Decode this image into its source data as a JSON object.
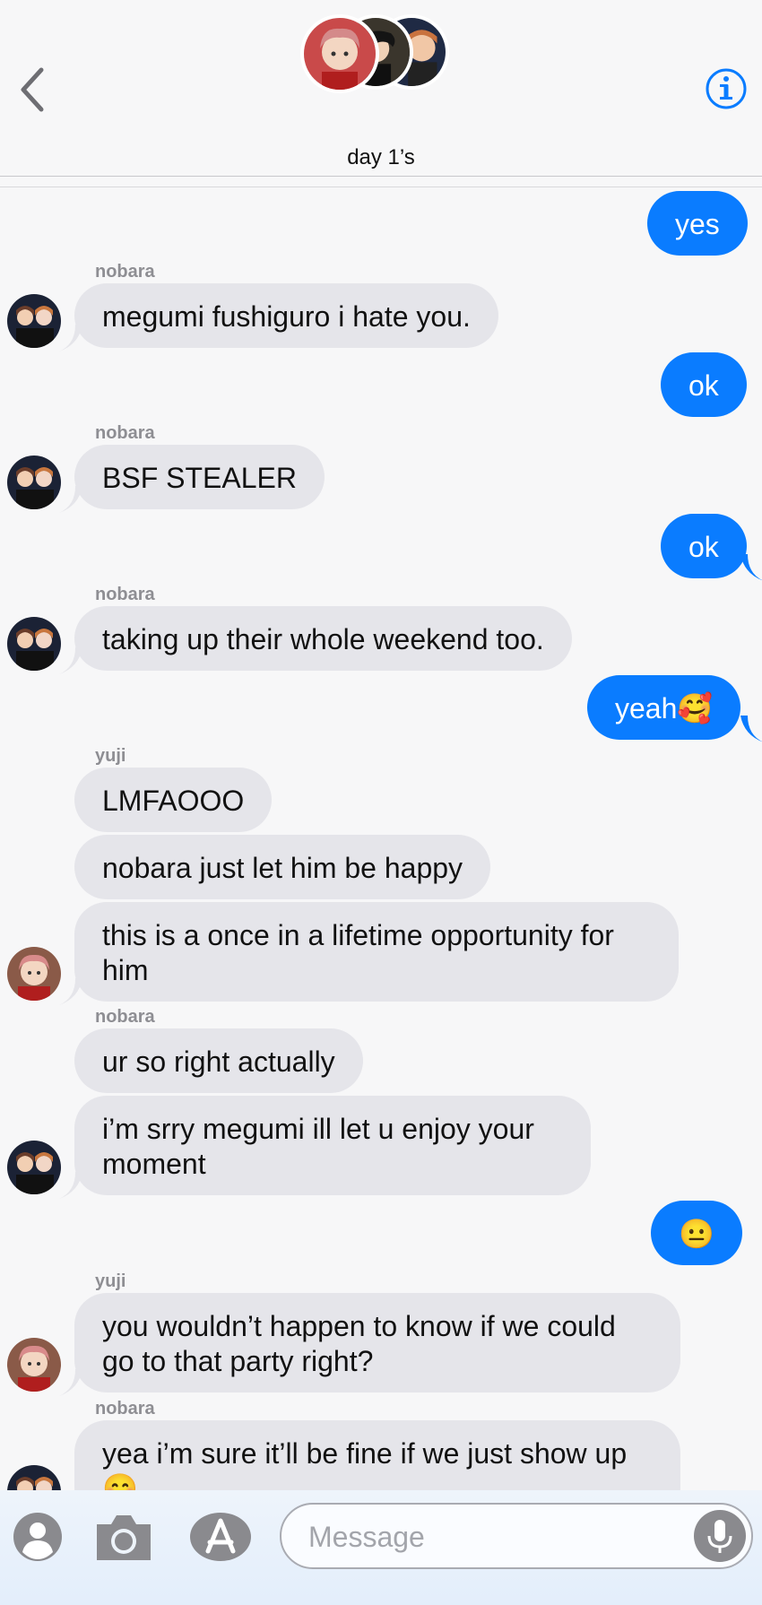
{
  "header": {
    "title": "day 1’s",
    "icons": {
      "back": "chevron-left-icon",
      "info": "info-icon"
    },
    "accent": "#0a7cff"
  },
  "messages": [
    {
      "side": "sent",
      "text": "yes"
    },
    {
      "side": "recv",
      "sender": "nobara",
      "text": "megumi fushiguro i hate you."
    },
    {
      "side": "sent",
      "text": "ok"
    },
    {
      "side": "recv",
      "sender": "nobara",
      "text": "BSF STEALER"
    },
    {
      "side": "sent",
      "text": "ok"
    },
    {
      "side": "recv",
      "sender": "nobara",
      "text": "taking up their whole weekend too."
    },
    {
      "side": "sent",
      "text": "yeah🥰"
    },
    {
      "side": "recv",
      "sender": "yuji",
      "text": "LMFAOOO"
    },
    {
      "side": "recv",
      "text": "nobara just let him be happy"
    },
    {
      "side": "recv",
      "text": "this is a once in a lifetime opportunity for him"
    },
    {
      "side": "recv",
      "sender": "nobara",
      "text": "ur so right actually"
    },
    {
      "side": "recv",
      "text": "i’m srry megumi ill let u enjoy your moment"
    },
    {
      "side": "sent",
      "text": "😐"
    },
    {
      "side": "recv",
      "sender": "yuji",
      "text": "you wouldn’t happen to know if we could go to that party right?"
    },
    {
      "side": "recv",
      "sender": "nobara",
      "text": "yea i’m sure it’ll be fine if we just show up 😊"
    }
  ],
  "input": {
    "placeholder": "Message",
    "icons": [
      "contact-icon",
      "camera-icon",
      "app-store-icon",
      "microphone-icon"
    ]
  },
  "colors": {
    "sent_bubble": "#0a7cff",
    "recv_bubble": "#e5e5ea",
    "background": "#f7f7f8"
  }
}
